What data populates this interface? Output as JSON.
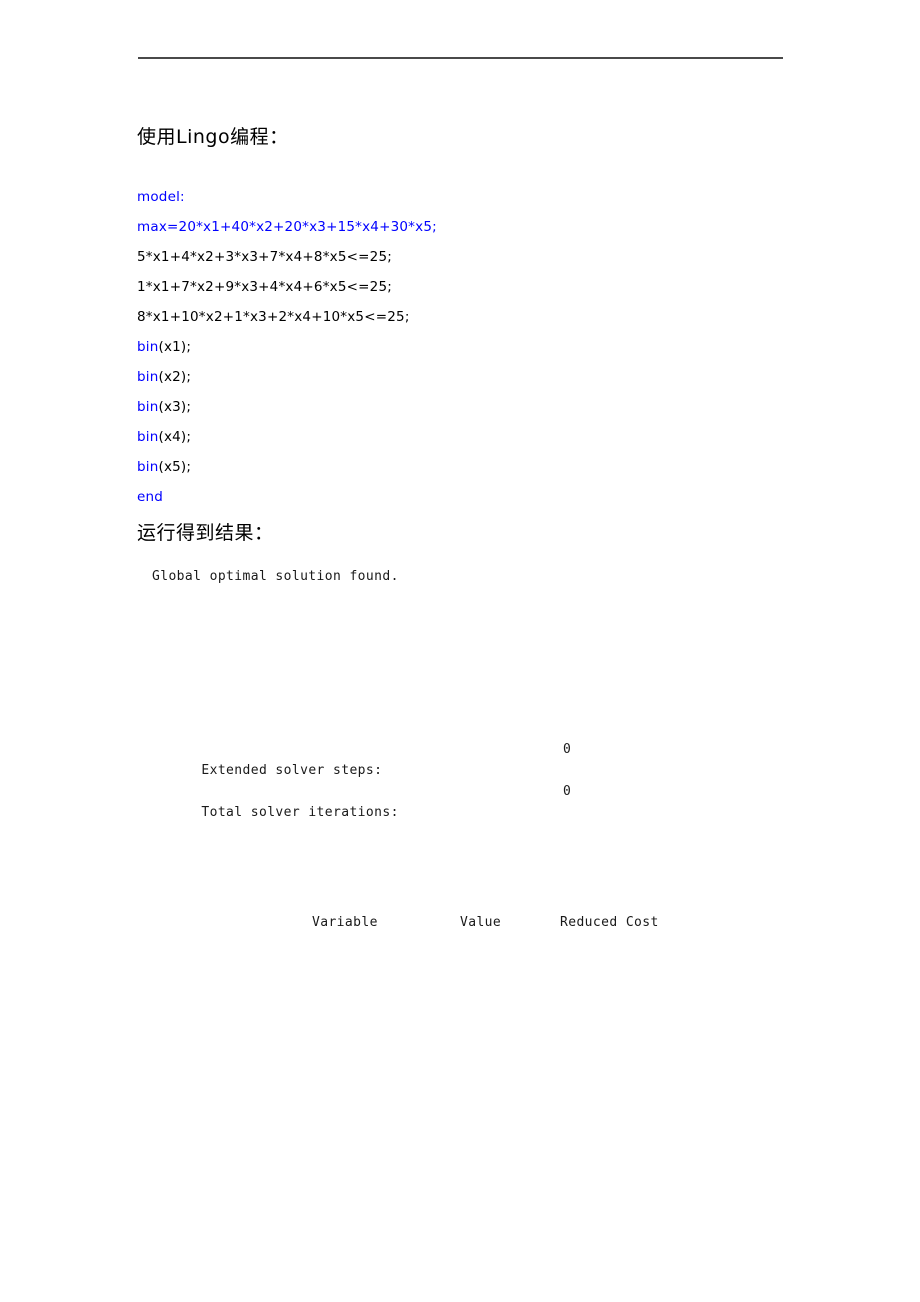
{
  "document": {
    "rule_color": "#4a4a4a",
    "code_keyword_color": "#0000ff",
    "body_text_color": "#000000"
  },
  "sections": {
    "code_heading": "使用Lingo编程：",
    "result_heading": "运行得到结果："
  },
  "code": {
    "lines": [
      {
        "text": "model:",
        "color": "blue",
        "parts": null
      },
      {
        "text": "max=20*x1+40*x2+20*x3+15*x4+30*x5;",
        "color": "blue",
        "parts": null
      },
      {
        "text": "5*x1+4*x2+3*x3+7*x4+8*x5<=25;",
        "color": "black",
        "parts": null
      },
      {
        "text": "1*x1+7*x2+9*x3+4*x4+6*x5<=25;",
        "color": "black",
        "parts": null
      },
      {
        "text": "8*x1+10*x2+1*x3+2*x4+10*x5<=25;",
        "color": "black",
        "parts": null
      },
      {
        "text": "bin(x1);",
        "color": "mixed",
        "parts": {
          "keyword": "bin",
          "rest": "(x1);"
        }
      },
      {
        "text": "bin(x2);",
        "color": "mixed",
        "parts": {
          "keyword": "bin",
          "rest": "(x2);"
        }
      },
      {
        "text": "bin(x3);",
        "color": "mixed",
        "parts": {
          "keyword": "bin",
          "rest": "(x3);"
        }
      },
      {
        "text": "bin(x4);",
        "color": "mixed",
        "parts": {
          "keyword": "bin",
          "rest": "(x4);"
        }
      },
      {
        "text": "bin(x5);",
        "color": "mixed",
        "parts": {
          "keyword": "bin",
          "rest": "(x5);"
        }
      },
      {
        "text": "end",
        "color": "blue",
        "parts": null
      }
    ],
    "line_0": "model:",
    "line_1": "max=20*x1+40*x2+20*x3+15*x4+30*x5;",
    "line_2": "5*x1+4*x2+3*x3+7*x4+8*x5<=25;",
    "line_3": "1*x1+7*x2+9*x3+4*x4+6*x5<=25;",
    "line_4": "8*x1+10*x2+1*x3+2*x4+10*x5<=25;",
    "kw_bin": "bin",
    "bin_1_rest": "(x1);",
    "bin_2_rest": "(x2);",
    "bin_3_rest": "(x3);",
    "bin_4_rest": "(x4);",
    "bin_5_rest": "(x5);",
    "line_end": "end"
  },
  "solver_output": {
    "status": "Global optimal solution found.",
    "extended_solver_steps_label": "Extended solver steps:",
    "extended_solver_steps_value": "0",
    "total_solver_iterations_label": "Total solver iterations:",
    "total_solver_iterations_value": "0"
  },
  "results_table": {
    "columns": {
      "variable": "Variable",
      "value": "Value",
      "reduced_cost": "Reduced Cost"
    },
    "rows": []
  }
}
